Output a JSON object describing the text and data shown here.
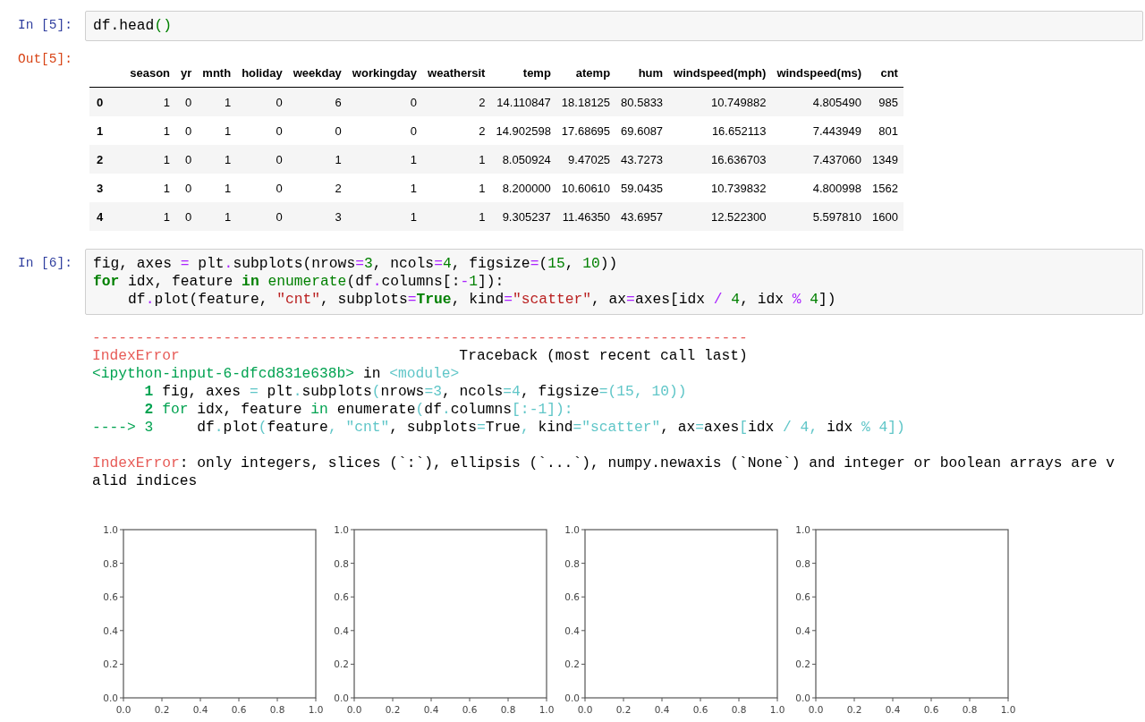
{
  "cells": [
    {
      "kind": "table",
      "in_prompt": "In [5]:",
      "out_prompt": "Out[5]:",
      "code": [
        [
          {
            "kind": "plain",
            "text": "df.head"
          },
          {
            "kind": "paren",
            "text": "()"
          }
        ]
      ],
      "table": {
        "columns": [
          "",
          "season",
          "yr",
          "mnth",
          "holiday",
          "weekday",
          "workingday",
          "weathersit",
          "temp",
          "atemp",
          "hum",
          "windspeed(mph)",
          "windspeed(ms)",
          "cnt"
        ],
        "rows": [
          [
            "0",
            "1",
            "0",
            "1",
            "0",
            "6",
            "0",
            "2",
            "14.110847",
            "18.18125",
            "80.5833",
            "10.749882",
            "4.805490",
            "985"
          ],
          [
            "1",
            "1",
            "0",
            "1",
            "0",
            "0",
            "0",
            "2",
            "14.902598",
            "17.68695",
            "69.6087",
            "16.652113",
            "7.443949",
            "801"
          ],
          [
            "2",
            "1",
            "0",
            "1",
            "0",
            "1",
            "1",
            "1",
            "8.050924",
            "9.47025",
            "43.7273",
            "16.636703",
            "7.437060",
            "1349"
          ],
          [
            "3",
            "1",
            "0",
            "1",
            "0",
            "2",
            "1",
            "1",
            "8.200000",
            "10.60610",
            "59.0435",
            "10.739832",
            "4.800998",
            "1562"
          ],
          [
            "4",
            "1",
            "0",
            "1",
            "0",
            "3",
            "1",
            "1",
            "9.305237",
            "11.46350",
            "43.6957",
            "12.522300",
            "5.597810",
            "1600"
          ]
        ]
      }
    },
    {
      "kind": "error",
      "in_prompt": "In [6]:",
      "code": [
        [
          {
            "kind": "plain",
            "text": "fig, axes "
          },
          {
            "kind": "op",
            "text": "="
          },
          {
            "kind": "plain",
            "text": " plt"
          },
          {
            "kind": "op",
            "text": "."
          },
          {
            "kind": "plain",
            "text": "subplots(nrows"
          },
          {
            "kind": "op",
            "text": "="
          },
          {
            "kind": "number",
            "text": "3"
          },
          {
            "kind": "plain",
            "text": ", ncols"
          },
          {
            "kind": "op",
            "text": "="
          },
          {
            "kind": "number",
            "text": "4"
          },
          {
            "kind": "plain",
            "text": ", figsize"
          },
          {
            "kind": "op",
            "text": "="
          },
          {
            "kind": "plain",
            "text": "("
          },
          {
            "kind": "number",
            "text": "15"
          },
          {
            "kind": "plain",
            "text": ", "
          },
          {
            "kind": "number",
            "text": "10"
          },
          {
            "kind": "plain",
            "text": "))"
          }
        ],
        [
          {
            "kind": "keyword",
            "text": "for"
          },
          {
            "kind": "plain",
            "text": " idx, feature "
          },
          {
            "kind": "keyword",
            "text": "in"
          },
          {
            "kind": "builtin",
            "text": " enumerate"
          },
          {
            "kind": "plain",
            "text": "(df"
          },
          {
            "kind": "op",
            "text": "."
          },
          {
            "kind": "plain",
            "text": "columns[:"
          },
          {
            "kind": "op",
            "text": "-"
          },
          {
            "kind": "number",
            "text": "1"
          },
          {
            "kind": "plain",
            "text": "]):"
          }
        ],
        [
          {
            "kind": "plain",
            "text": "    df"
          },
          {
            "kind": "op",
            "text": "."
          },
          {
            "kind": "plain",
            "text": "plot(feature, "
          },
          {
            "kind": "string",
            "text": "\"cnt\""
          },
          {
            "kind": "plain",
            "text": ", subplots"
          },
          {
            "kind": "op",
            "text": "="
          },
          {
            "kind": "keyword",
            "text": "True"
          },
          {
            "kind": "plain",
            "text": ", kind"
          },
          {
            "kind": "op",
            "text": "="
          },
          {
            "kind": "string",
            "text": "\"scatter\""
          },
          {
            "kind": "plain",
            "text": ", ax"
          },
          {
            "kind": "op",
            "text": "="
          },
          {
            "kind": "plain",
            "text": "axes[idx "
          },
          {
            "kind": "op",
            "text": "/ "
          },
          {
            "kind": "number",
            "text": "4"
          },
          {
            "kind": "plain",
            "text": ", idx "
          },
          {
            "kind": "op",
            "text": "% "
          },
          {
            "kind": "number",
            "text": "4"
          },
          {
            "kind": "plain",
            "text": "])"
          }
        ]
      ],
      "traceback": [
        [
          {
            "kind": "red",
            "text": "---------------------------------------------------------------------------"
          }
        ],
        [
          {
            "kind": "red",
            "text": "IndexError"
          },
          {
            "kind": "plain",
            "text": "                                Traceback (most recent call last)"
          }
        ],
        [
          {
            "kind": "green",
            "text": "<ipython-input-6-dfcd831e638b>"
          },
          {
            "kind": "plain",
            "text": " in "
          },
          {
            "kind": "cyan",
            "text": "<module>"
          }
        ],
        [
          {
            "kind": "green-bold",
            "text": "      1"
          },
          {
            "kind": "plain",
            "text": " fig"
          },
          {
            "kind": "plain",
            "text": ", axes "
          },
          {
            "kind": "cyan",
            "text": "="
          },
          {
            "kind": "plain",
            "text": " plt"
          },
          {
            "kind": "cyan",
            "text": "."
          },
          {
            "kind": "plain",
            "text": "subplots"
          },
          {
            "kind": "cyan",
            "text": "("
          },
          {
            "kind": "plain",
            "text": "nrows"
          },
          {
            "kind": "cyan",
            "text": "=3"
          },
          {
            "kind": "plain",
            "text": ", ncols"
          },
          {
            "kind": "cyan",
            "text": "=4"
          },
          {
            "kind": "plain",
            "text": ", figsize"
          },
          {
            "kind": "cyan",
            "text": "=(15, 10))"
          }
        ],
        [
          {
            "kind": "green-bold",
            "text": "      2"
          },
          {
            "kind": "green",
            "text": " for"
          },
          {
            "kind": "plain",
            "text": " idx"
          },
          {
            "kind": "plain",
            "text": ", feature "
          },
          {
            "kind": "green",
            "text": "in"
          },
          {
            "kind": "plain",
            "text": " enumerate"
          },
          {
            "kind": "cyan",
            "text": "("
          },
          {
            "kind": "plain",
            "text": "df"
          },
          {
            "kind": "cyan",
            "text": "."
          },
          {
            "kind": "plain",
            "text": "columns"
          },
          {
            "kind": "cyan",
            "text": "[:-1]):"
          }
        ],
        [
          {
            "kind": "green",
            "text": "----> 3"
          },
          {
            "kind": "plain",
            "text": "     df"
          },
          {
            "kind": "cyan",
            "text": "."
          },
          {
            "kind": "plain",
            "text": "plot"
          },
          {
            "kind": "cyan",
            "text": "("
          },
          {
            "kind": "plain",
            "text": "feature"
          },
          {
            "kind": "cyan",
            "text": ", \"cnt\""
          },
          {
            "kind": "plain",
            "text": ", subplots"
          },
          {
            "kind": "cyan",
            "text": "="
          },
          {
            "kind": "plain",
            "text": "True"
          },
          {
            "kind": "cyan",
            "text": ", "
          },
          {
            "kind": "plain",
            "text": "kind"
          },
          {
            "kind": "cyan",
            "text": "=\"scatter\""
          },
          {
            "kind": "plain",
            "text": ", ax"
          },
          {
            "kind": "cyan",
            "text": "="
          },
          {
            "kind": "plain",
            "text": "axes"
          },
          {
            "kind": "cyan",
            "text": "["
          },
          {
            "kind": "plain",
            "text": "idx "
          },
          {
            "kind": "cyan",
            "text": "/ 4,"
          },
          {
            "kind": "plain",
            "text": " idx "
          },
          {
            "kind": "cyan",
            "text": "% 4])"
          }
        ]
      ],
      "message": [
        [
          {
            "kind": "red",
            "text": "IndexError"
          },
          {
            "kind": "plain",
            "text": ": only integers, slices (`:`), ellipsis (`...`), numpy.newaxis (`None`) and integer or boolean arrays are v"
          }
        ],
        [
          {
            "kind": "plain",
            "text": "alid indices"
          }
        ]
      ],
      "charts": [
        {
          "chart_data": {
            "type": "scatter",
            "xlim": [
              0,
              1
            ],
            "ylim": [
              0,
              1
            ],
            "xticks": [
              {
                "value": 0,
                "label": "0.0"
              },
              {
                "value": 0.2,
                "label": "0.2"
              },
              {
                "value": 0.4,
                "label": "0.4"
              },
              {
                "value": 0.6,
                "label": "0.6"
              },
              {
                "value": 0.8,
                "label": "0.8"
              },
              {
                "value": 1,
                "label": "1.0"
              }
            ],
            "yticks": [
              {
                "value": 0,
                "label": "0.0"
              },
              {
                "value": 0.2,
                "label": "0.2"
              },
              {
                "value": 0.4,
                "label": "0.4"
              },
              {
                "value": 0.6,
                "label": "0.6"
              },
              {
                "value": 0.8,
                "label": "0.8"
              },
              {
                "value": 1,
                "label": "1.0"
              }
            ]
          }
        },
        {
          "chart_data": {
            "type": "scatter",
            "xlim": [
              0,
              1
            ],
            "ylim": [
              0,
              1
            ],
            "xticks": [
              {
                "value": 0,
                "label": "0.0"
              },
              {
                "value": 0.2,
                "label": "0.2"
              },
              {
                "value": 0.4,
                "label": "0.4"
              },
              {
                "value": 0.6,
                "label": "0.6"
              },
              {
                "value": 0.8,
                "label": "0.8"
              },
              {
                "value": 1,
                "label": "1.0"
              }
            ],
            "yticks": [
              {
                "value": 0,
                "label": "0.0"
              },
              {
                "value": 0.2,
                "label": "0.2"
              },
              {
                "value": 0.4,
                "label": "0.4"
              },
              {
                "value": 0.6,
                "label": "0.6"
              },
              {
                "value": 0.8,
                "label": "0.8"
              },
              {
                "value": 1,
                "label": "1.0"
              }
            ]
          }
        },
        {
          "chart_data": {
            "type": "scatter",
            "xlim": [
              0,
              1
            ],
            "ylim": [
              0,
              1
            ],
            "xticks": [
              {
                "value": 0,
                "label": "0.0"
              },
              {
                "value": 0.2,
                "label": "0.2"
              },
              {
                "value": 0.4,
                "label": "0.4"
              },
              {
                "value": 0.6,
                "label": "0.6"
              },
              {
                "value": 0.8,
                "label": "0.8"
              },
              {
                "value": 1,
                "label": "1.0"
              }
            ],
            "yticks": [
              {
                "value": 0,
                "label": "0.0"
              },
              {
                "value": 0.2,
                "label": "0.2"
              },
              {
                "value": 0.4,
                "label": "0.4"
              },
              {
                "value": 0.6,
                "label": "0.6"
              },
              {
                "value": 0.8,
                "label": "0.8"
              },
              {
                "value": 1,
                "label": "1.0"
              }
            ]
          }
        },
        {
          "chart_data": {
            "type": "scatter",
            "xlim": [
              0,
              1
            ],
            "ylim": [
              0,
              1
            ],
            "xticks": [
              {
                "value": 0,
                "label": "0.0"
              },
              {
                "value": 0.2,
                "label": "0.2"
              },
              {
                "value": 0.4,
                "label": "0.4"
              },
              {
                "value": 0.6,
                "label": "0.6"
              },
              {
                "value": 0.8,
                "label": "0.8"
              },
              {
                "value": 1,
                "label": "1.0"
              }
            ],
            "yticks": [
              {
                "value": 0,
                "label": "0.0"
              },
              {
                "value": 0.2,
                "label": "0.2"
              },
              {
                "value": 0.4,
                "label": "0.4"
              },
              {
                "value": 0.6,
                "label": "0.6"
              },
              {
                "value": 0.8,
                "label": "0.8"
              },
              {
                "value": 1,
                "label": "1.0"
              }
            ]
          }
        }
      ]
    }
  ]
}
